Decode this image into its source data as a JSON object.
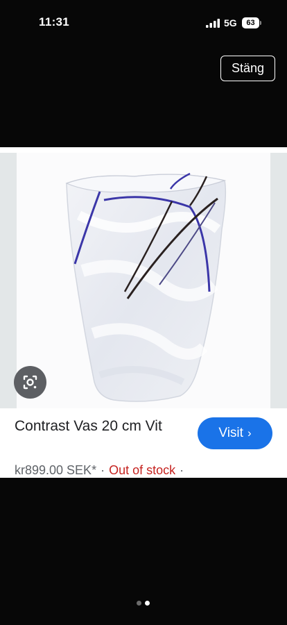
{
  "status_bar": {
    "time": "11:31",
    "network": "5G",
    "battery": "63"
  },
  "close_label": "Stäng",
  "product": {
    "title": "Contrast Vas 20 cm Vit",
    "price": "kr899.00 SEK*",
    "separator": "·",
    "stock": "Out of stock",
    "trailing_separator": "·"
  },
  "visit": {
    "label": "Visit",
    "chevron": "›"
  },
  "icons": {
    "lens": "lens-camera-icon",
    "signal": "cellular-signal-icon",
    "battery": "battery-icon"
  },
  "pager": {
    "count": 2,
    "active_index": 1
  },
  "colors": {
    "accent": "#1a73e8",
    "out_of_stock": "#c5221f",
    "background": "#070707"
  }
}
